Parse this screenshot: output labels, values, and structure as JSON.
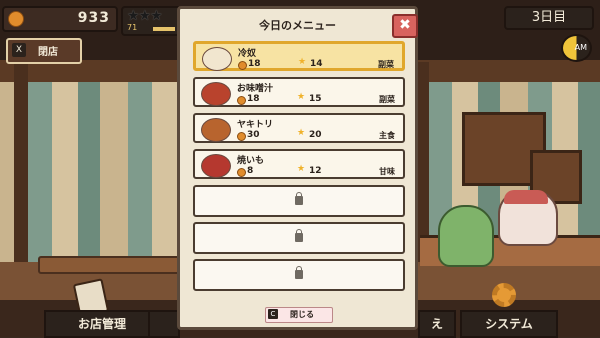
{
  "hud": {
    "coins": "933",
    "stars": "★★★",
    "reputation": "71",
    "day": "3日目",
    "clock": "AM",
    "shop": {
      "key": "X",
      "label": "閉店"
    }
  },
  "bottom_menu": {
    "left": "お店管理",
    "partial": "え",
    "right": "システム"
  },
  "modal": {
    "title": "今日のメニュー",
    "close_symbol": "✖",
    "footer": {
      "key": "C",
      "label": "閉じる"
    },
    "items": [
      {
        "name": "冷奴",
        "cost": "18",
        "reputation": "14",
        "category": "副菜",
        "color": "#f1e6cf"
      },
      {
        "name": "お味噌汁",
        "cost": "18",
        "reputation": "15",
        "category": "副菜",
        "color": "#b9432d"
      },
      {
        "name": "ヤキトリ",
        "cost": "30",
        "reputation": "20",
        "category": "主食",
        "color": "#b8642e"
      },
      {
        "name": "焼いも",
        "cost": "8",
        "reputation": "12",
        "category": "甘味",
        "color": "#b5382f"
      }
    ],
    "locked_slots": 3
  }
}
